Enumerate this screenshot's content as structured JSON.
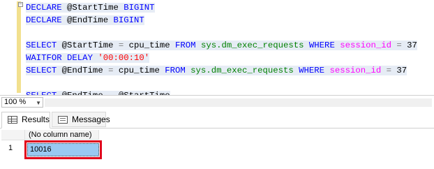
{
  "editor": {
    "lines": [
      [
        {
          "t": "DECLARE",
          "c": "kw"
        },
        {
          "t": " @StartTime ",
          "c": "id"
        },
        {
          "t": "BIGINT",
          "c": "kw"
        }
      ],
      [
        {
          "t": "DECLARE",
          "c": "kw"
        },
        {
          "t": " @EndTime ",
          "c": "id"
        },
        {
          "t": "BIGINT",
          "c": "kw"
        }
      ],
      [],
      [
        {
          "t": "SELECT",
          "c": "kw"
        },
        {
          "t": " @StartTime ",
          "c": "id"
        },
        {
          "t": "=",
          "c": "op"
        },
        {
          "t": " cpu_time ",
          "c": "id"
        },
        {
          "t": "FROM",
          "c": "kw"
        },
        {
          "t": " sys.dm_exec_requests ",
          "c": "sys"
        },
        {
          "t": "WHERE",
          "c": "kw"
        },
        {
          "t": " ",
          "c": "id"
        },
        {
          "t": "session_id",
          "c": "fn"
        },
        {
          "t": " ",
          "c": "id"
        },
        {
          "t": "=",
          "c": "op"
        },
        {
          "t": " 37",
          "c": "num"
        }
      ],
      [
        {
          "t": "WAITFOR",
          "c": "kw"
        },
        {
          "t": " ",
          "c": "id"
        },
        {
          "t": "DELAY",
          "c": "kw"
        },
        {
          "t": " ",
          "c": "id"
        },
        {
          "t": "'00:00:10'",
          "c": "str"
        }
      ],
      [
        {
          "t": "SELECT",
          "c": "kw"
        },
        {
          "t": " @EndTime ",
          "c": "id"
        },
        {
          "t": "=",
          "c": "op"
        },
        {
          "t": " cpu_time ",
          "c": "id"
        },
        {
          "t": "FROM",
          "c": "kw"
        },
        {
          "t": " sys.dm_exec_requests ",
          "c": "sys"
        },
        {
          "t": "WHERE",
          "c": "kw"
        },
        {
          "t": " ",
          "c": "id"
        },
        {
          "t": "session_id",
          "c": "fn"
        },
        {
          "t": " ",
          "c": "id"
        },
        {
          "t": "=",
          "c": "op"
        },
        {
          "t": " 37",
          "c": "num"
        }
      ],
      [],
      [
        {
          "t": "SELECT",
          "c": "kw"
        },
        {
          "t": " @EndTime ",
          "c": "id"
        },
        {
          "t": "-",
          "c": "op"
        },
        {
          "t": " @StartTime",
          "c": "id"
        }
      ]
    ]
  },
  "zoom": {
    "value": "100 %"
  },
  "tabs": {
    "results_label": "Results",
    "messages_label": "Messages"
  },
  "grid": {
    "column_header": "(No column name)",
    "rows": [
      {
        "row_number": "1",
        "value": "10016"
      }
    ]
  },
  "colors": {
    "keyword": "#0000ff",
    "system_object": "#008000",
    "function": "#ff00ff",
    "string": "#ff0000",
    "operator": "#808080",
    "selected_cell": "#99c9f2",
    "highlight_box": "#e0001b"
  }
}
